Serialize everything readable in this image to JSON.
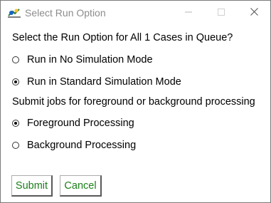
{
  "window": {
    "title": "Select Run Option",
    "app_icon": "run-app-icon",
    "controls": [
      "minimize-icon",
      "maximize-icon",
      "close-icon"
    ]
  },
  "run_option": {
    "question": "Select the Run Option for All 1 Cases in Queue?",
    "options": [
      {
        "label": "Run in No Simulation Mode",
        "checked": false
      },
      {
        "label": "Run in Standard Simulation Mode",
        "checked": true
      }
    ]
  },
  "processing": {
    "question": "Submit jobs for foreground or background processing",
    "options": [
      {
        "label": "Foreground Processing",
        "checked": true
      },
      {
        "label": "Background Processing",
        "checked": false
      }
    ]
  },
  "buttons": {
    "submit_label": "Submit",
    "cancel_label": "Cancel"
  },
  "colors": {
    "button_text": "#1a7f1a",
    "title_text": "#8c8c8c"
  }
}
